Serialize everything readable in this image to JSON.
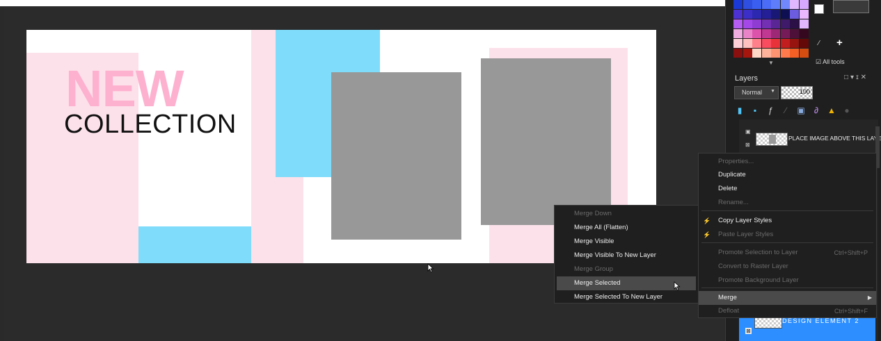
{
  "canvas": {
    "headline": "NEW",
    "subheadline": "COLLECTION",
    "colors": {
      "pink_light": "#fde1ea",
      "pink_text": "#fdb1cf",
      "cyan": "#7fdcfa",
      "gray": "#989898",
      "white": "#ffffff"
    }
  },
  "palette": {
    "all_tools_label": "All tools",
    "colors": [
      [
        "#1b39d4",
        "#2f4fe0",
        "#3a5ef0",
        "#4a6cf7",
        "#5d7dfa",
        "#7088fb",
        "#e1b8ff",
        "#d6a8ff"
      ],
      [
        "#4c33d1",
        "#3b2fc7",
        "#2d28b0",
        "#241f96",
        "#1a1877",
        "#0e0f52",
        "#6b5ce0",
        "#ebb8ff"
      ],
      [
        "#b55cf2",
        "#a548e8",
        "#8f3cd3",
        "#7430b4",
        "#5a2695",
        "#3f1a6b",
        "#2b0f47",
        "#e2b5ff"
      ],
      [
        "#f0aee0",
        "#ea84c9",
        "#dc53ab",
        "#c13892",
        "#9c2876",
        "#751c58",
        "#4e1039",
        "#36081f"
      ],
      [
        "#ffd0d8",
        "#ffc0c0",
        "#ff7f8a",
        "#f94d5f",
        "#e8333a",
        "#c21e1f",
        "#97140f",
        "#650908"
      ],
      [
        "#8a1010",
        "#a5160e",
        "#ffd8c8",
        "#ffb39a",
        "#ff9472",
        "#ff7a4d",
        "#f45f25",
        "#d64d12"
      ]
    ]
  },
  "layers": {
    "title": "Layers",
    "blend_mode": "Normal",
    "opacity": "100",
    "layer_top_name": "PLACE IMAGE ABOVE THIS LAYER",
    "layer_selected_name": "DESIGN ELEMENT 2"
  },
  "context_menu": {
    "items": [
      {
        "label": "Properties...",
        "disabled": true,
        "shortcut": ""
      },
      {
        "label": "Duplicate",
        "disabled": false,
        "shortcut": ""
      },
      {
        "label": "Delete",
        "disabled": false,
        "shortcut": ""
      },
      {
        "label": "Rename...",
        "disabled": true,
        "shortcut": ""
      },
      {
        "label": "Copy Layer Styles",
        "disabled": false,
        "shortcut": ""
      },
      {
        "label": "Paste Layer Styles",
        "disabled": true,
        "shortcut": ""
      },
      {
        "label": "Promote Selection to Layer",
        "disabled": true,
        "shortcut": "Ctrl+Shift+P"
      },
      {
        "label": "Convert to Raster Layer",
        "disabled": true,
        "shortcut": ""
      },
      {
        "label": "Promote Background Layer",
        "disabled": true,
        "shortcut": ""
      },
      {
        "label": "Merge",
        "disabled": false,
        "shortcut": ""
      },
      {
        "label": "Defloat",
        "disabled": true,
        "shortcut": "Ctrl+Shift+F"
      }
    ]
  },
  "merge_menu": {
    "items": [
      {
        "label": "Merge Down",
        "disabled": true
      },
      {
        "label": "Merge All (Flatten)",
        "disabled": false
      },
      {
        "label": "Merge Visible",
        "disabled": false
      },
      {
        "label": "Merge Visible To New Layer",
        "disabled": false
      },
      {
        "label": "Merge Group",
        "disabled": true
      },
      {
        "label": "Merge Selected",
        "disabled": false
      },
      {
        "label": "Merge Selected To New Layer",
        "disabled": false
      }
    ]
  }
}
